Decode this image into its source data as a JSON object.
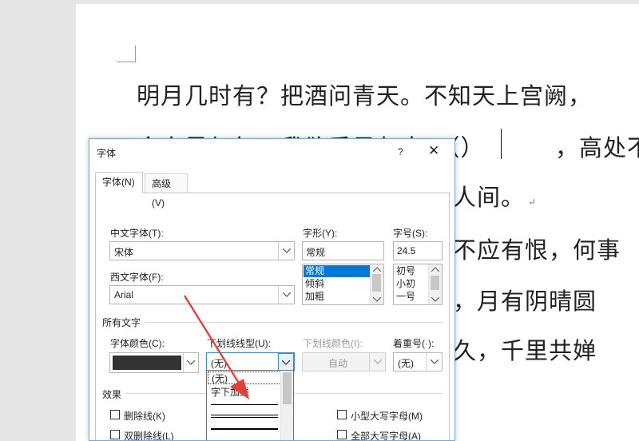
{
  "document": {
    "lines": [
      "明月几时有？把酒问青天。不知天上宫阙，",
      "今夕是何年。我欲乘风归去，（）",
      "，高处不",
      "人间。",
      "不应有恨，何事",
      "，月有阴晴圆",
      "久，千里共婵"
    ],
    "paragraph_mark": "↵"
  },
  "dialog": {
    "title": "字体",
    "help": "?",
    "close": "✕",
    "tabs": [
      {
        "label": "字体(N)",
        "active": true
      },
      {
        "label": "高级(V)",
        "active": false
      }
    ],
    "chinese_font": {
      "label": "中文字体(T):",
      "value": "宋体"
    },
    "western_font": {
      "label": "西文字体(F):",
      "value": "Arial"
    },
    "font_style": {
      "label": "字形(Y):",
      "value": "常规",
      "options": [
        "常规",
        "倾斜",
        "加粗"
      ],
      "selected": "常规"
    },
    "font_size": {
      "label": "字号(S):",
      "value": "24.5",
      "options": [
        "初号",
        "小初",
        "一号"
      ]
    },
    "all_text_section": "所有文字",
    "font_color": {
      "label": "字体颜色(C):",
      "color": "#333333"
    },
    "underline_style": {
      "label": "下划线线型(U):",
      "value": "(无)",
      "options": [
        "(无)",
        "字下加线"
      ]
    },
    "underline_color": {
      "label": "下划线颜色(I):",
      "value": "自动"
    },
    "emphasis_mark": {
      "label": "着重号(·):",
      "value": "(无)"
    },
    "effects_section": "效果",
    "effects": [
      {
        "label": "删除线(K)",
        "checked": false
      },
      {
        "label": "双删除线(L)",
        "checked": false
      },
      {
        "label": "小型大写字母(M)",
        "checked": false
      },
      {
        "label": "全部大写字母(A)",
        "checked": false
      }
    ]
  },
  "colors": {
    "accent": "#0078d7",
    "annotation_arrow": "#e0423a"
  }
}
